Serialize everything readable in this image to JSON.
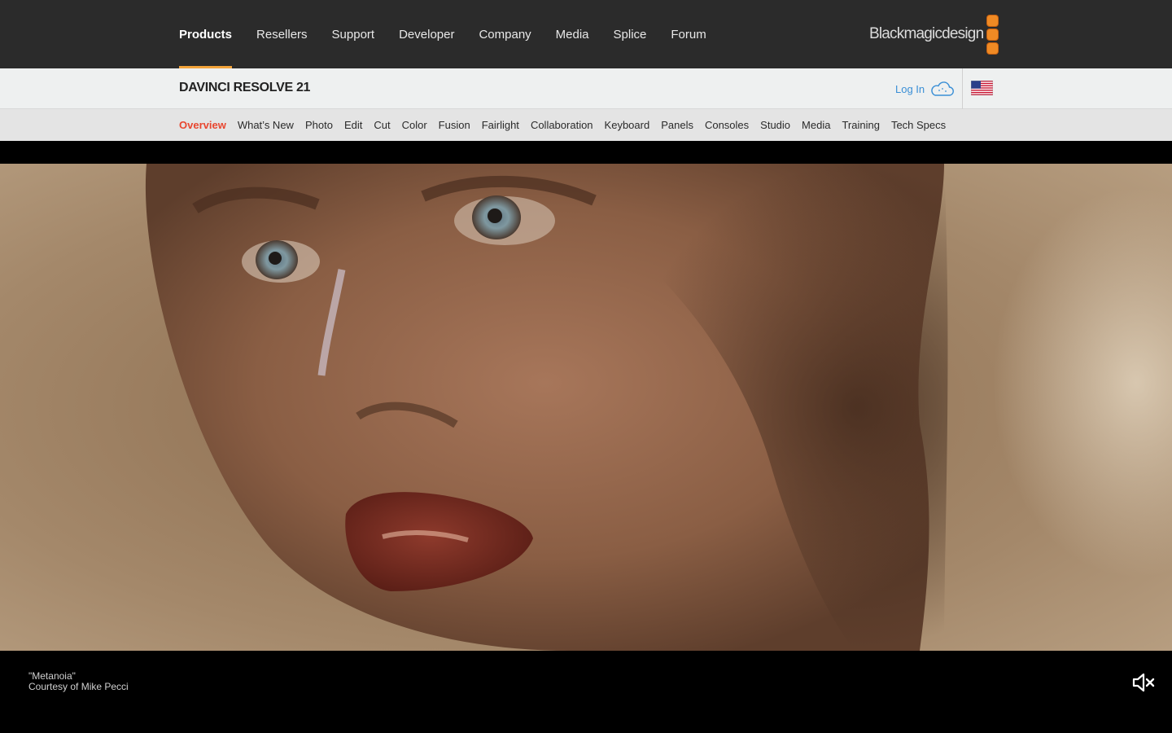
{
  "topnav": {
    "links": [
      {
        "label": "Products",
        "active": true
      },
      {
        "label": "Resellers"
      },
      {
        "label": "Support"
      },
      {
        "label": "Developer"
      },
      {
        "label": "Company"
      },
      {
        "label": "Media"
      },
      {
        "label": "Splice"
      },
      {
        "label": "Forum"
      }
    ],
    "logo_text": "Blackmagicdesign"
  },
  "productbar": {
    "title": "DAVINCI RESOLVE 21",
    "login_label": "Log In"
  },
  "subnav": {
    "items": [
      {
        "label": "Overview",
        "active": true
      },
      {
        "label": "What’s New"
      },
      {
        "label": "Photo"
      },
      {
        "label": "Edit"
      },
      {
        "label": "Cut"
      },
      {
        "label": "Color"
      },
      {
        "label": "Fusion"
      },
      {
        "label": "Fairlight"
      },
      {
        "label": "Collaboration"
      },
      {
        "label": "Keyboard"
      },
      {
        "label": "Panels"
      },
      {
        "label": "Consoles"
      },
      {
        "label": "Studio"
      },
      {
        "label": "Media"
      },
      {
        "label": "Training"
      },
      {
        "label": "Tech Specs"
      }
    ]
  },
  "hero": {
    "caption_title": "\"Metanoia\"",
    "caption_credit": "Courtesy of Mike Pecci"
  },
  "colors": {
    "accent_orange": "#f2a33a",
    "subnav_active": "#e8462f",
    "login_blue": "#3a8fd6"
  },
  "icons": [
    "cloud-icon",
    "us-flag-icon",
    "mute-icon"
  ]
}
